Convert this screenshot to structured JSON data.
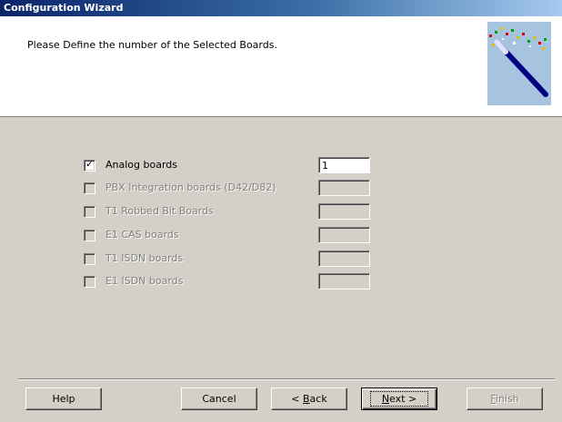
{
  "window": {
    "title": "Configuration Wizard"
  },
  "header": {
    "instruction": "Please Define the number of the Selected Boards.",
    "image_icon": "magic-wand-icon"
  },
  "boards": [
    {
      "label": "Analog boards",
      "checked": true,
      "enabled": true,
      "value": "1"
    },
    {
      "label": "PBX Integration boards (D42/D82)",
      "checked": false,
      "enabled": false,
      "value": ""
    },
    {
      "label": "T1 Robbed Bit Boards",
      "checked": false,
      "enabled": false,
      "value": ""
    },
    {
      "label": "E1 CAS boards",
      "checked": false,
      "enabled": false,
      "value": ""
    },
    {
      "label": "T1 ISDN boards",
      "checked": false,
      "enabled": false,
      "value": ""
    },
    {
      "label": "E1 ISDN boards",
      "checked": false,
      "enabled": false,
      "value": ""
    }
  ],
  "buttons": {
    "help": "Help",
    "cancel": "Cancel",
    "back_prefix": "< ",
    "back_mnemonic": "B",
    "back_rest": "ack",
    "next_mnemonic": "N",
    "next_rest": "ext >",
    "finish_mnemonic": "F",
    "finish_rest": "inish"
  }
}
